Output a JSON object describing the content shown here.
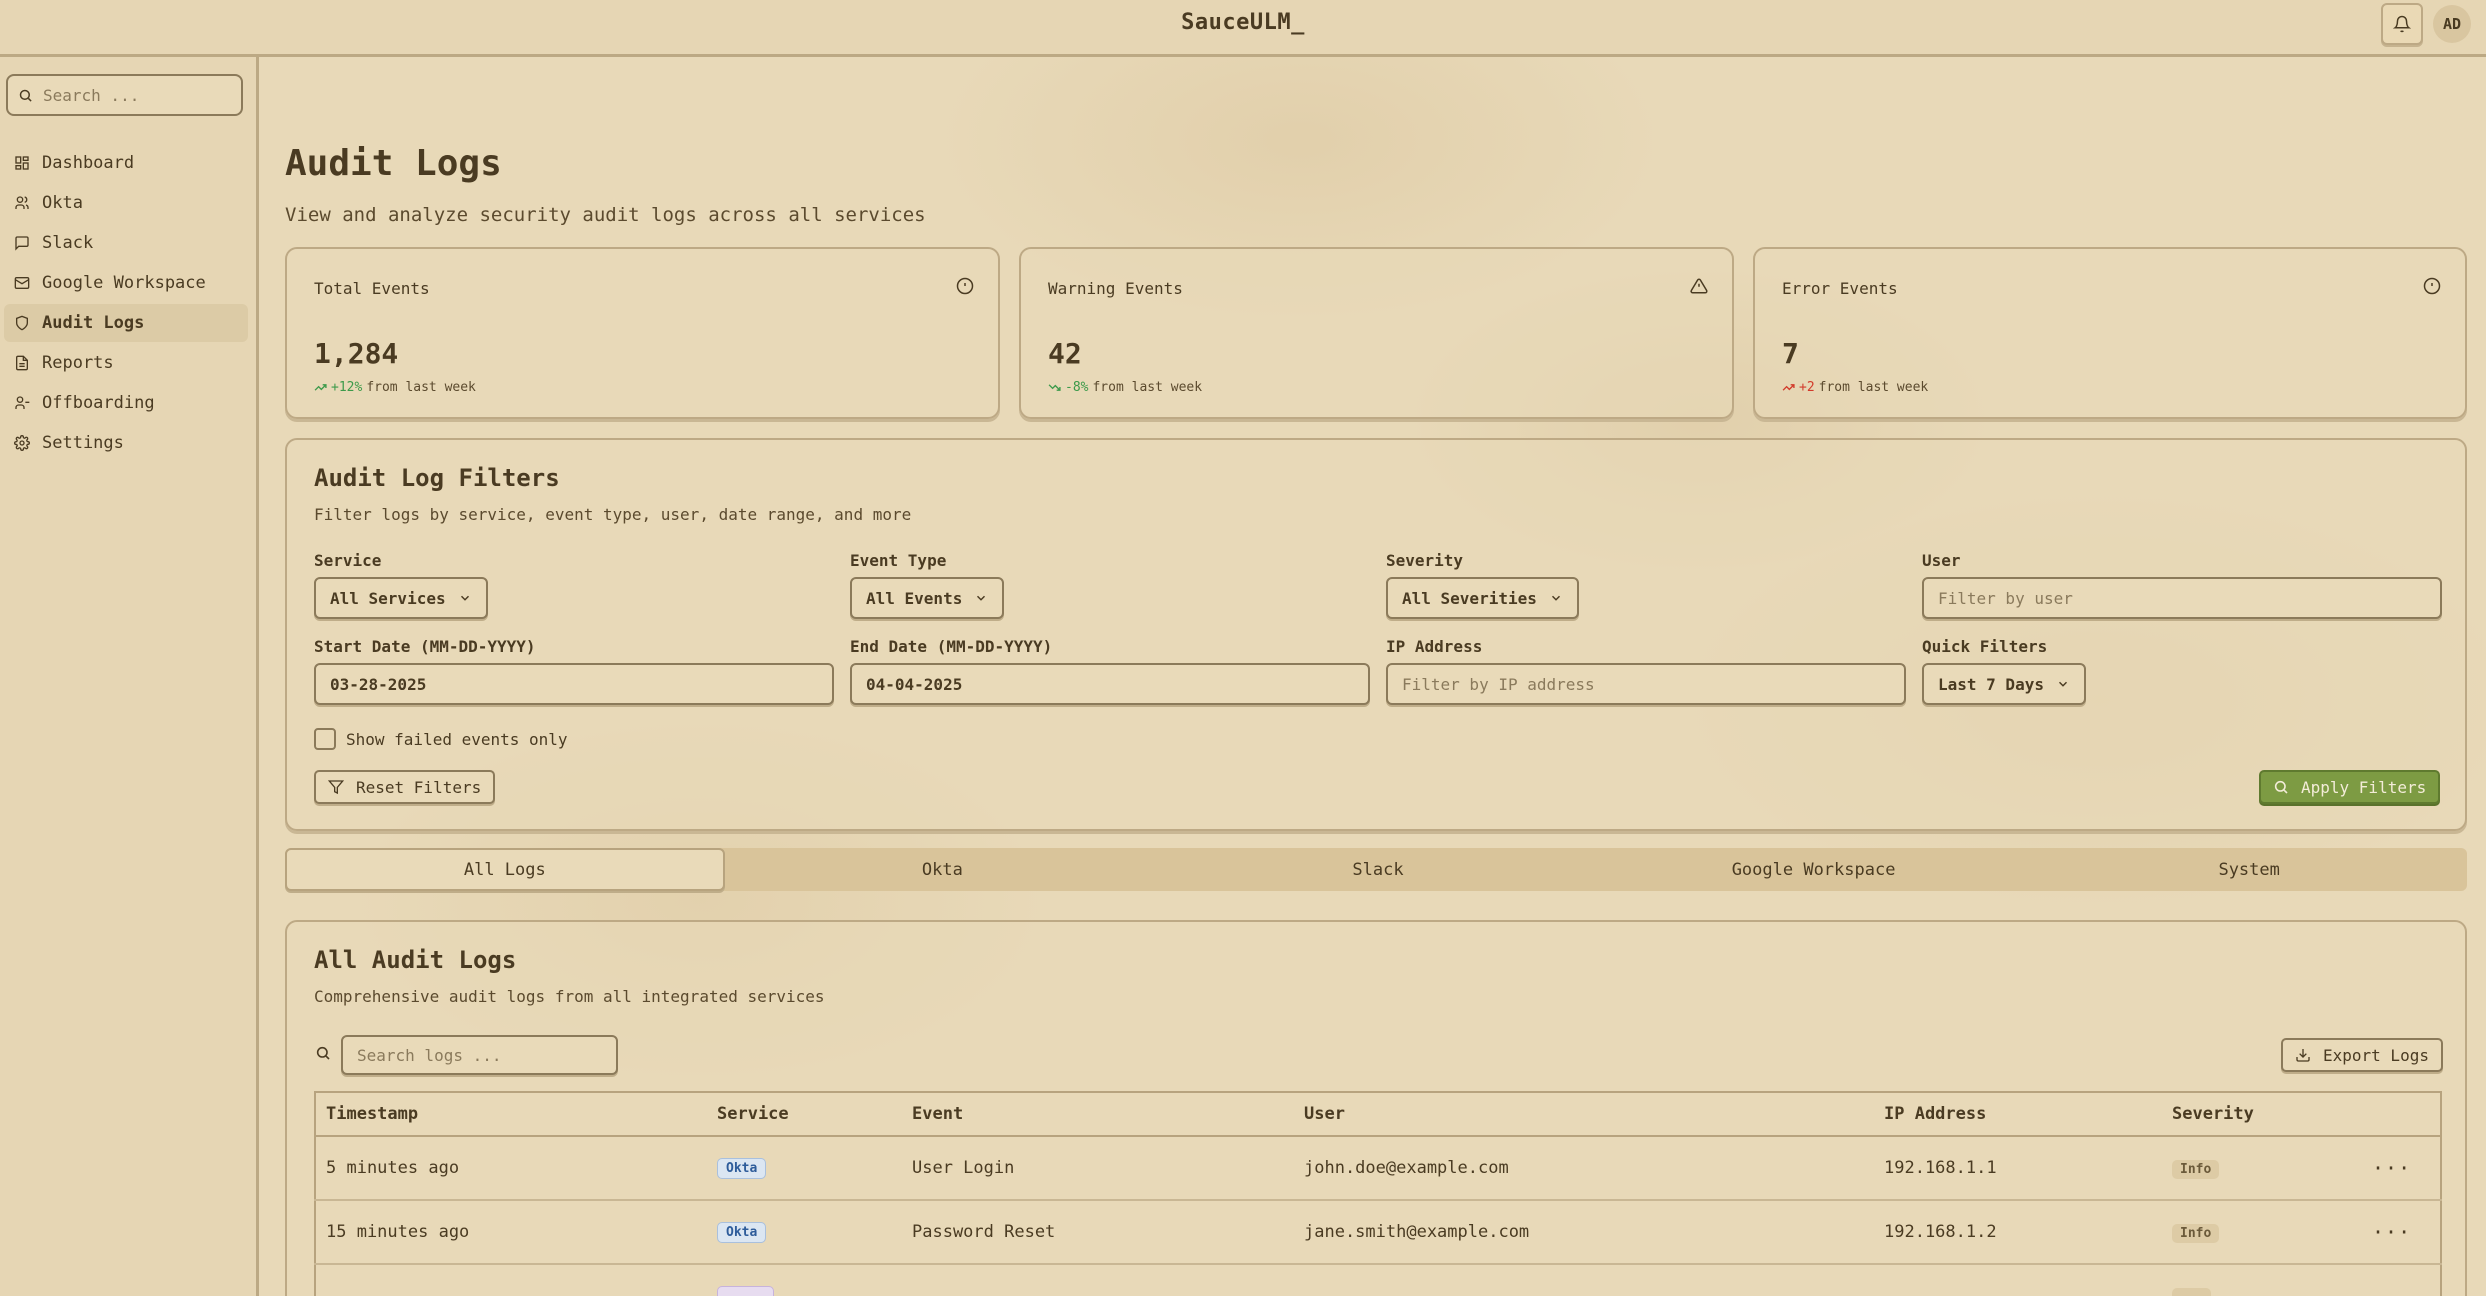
{
  "app": {
    "title": "SauceULM_",
    "avatar_initials": "AD"
  },
  "sidebar": {
    "search_placeholder": "Search ...",
    "items": [
      {
        "label": "Dashboard",
        "icon": "dashboard-icon"
      },
      {
        "label": "Okta",
        "icon": "users-icon"
      },
      {
        "label": "Slack",
        "icon": "message-icon"
      },
      {
        "label": "Google Workspace",
        "icon": "mail-icon"
      },
      {
        "label": "Audit Logs",
        "icon": "shield-icon",
        "active": true
      },
      {
        "label": "Reports",
        "icon": "file-icon"
      },
      {
        "label": "Offboarding",
        "icon": "user-minus-icon"
      },
      {
        "label": "Settings",
        "icon": "gear-icon"
      }
    ]
  },
  "page": {
    "title": "Audit Logs",
    "subtitle": "View and analyze security audit logs across all services"
  },
  "stats": [
    {
      "label": "Total Events",
      "value": "1,284",
      "change": "+12%",
      "change_suffix": "from last week",
      "icon": "info-icon"
    },
    {
      "label": "Warning Events",
      "value": "42",
      "change": "-8%",
      "change_suffix": "from last week",
      "icon": "warning-triangle-icon"
    },
    {
      "label": "Error Events",
      "value": "7",
      "change": "+2",
      "change_suffix": "from last week",
      "icon": "info-icon"
    }
  ],
  "filters": {
    "title": "Audit Log Filters",
    "subtitle": "Filter logs by service, event type, user, date range, and more",
    "service": {
      "label": "Service",
      "value": "All Services"
    },
    "event_type": {
      "label": "Event Type",
      "value": "All Events"
    },
    "severity": {
      "label": "Severity",
      "value": "All Severities"
    },
    "user": {
      "label": "User",
      "placeholder": "Filter by user"
    },
    "start_date": {
      "label": "Start Date (MM-DD-YYYY)",
      "value": "03-28-2025"
    },
    "end_date": {
      "label": "End Date (MM-DD-YYYY)",
      "value": "04-04-2025"
    },
    "ip": {
      "label": "IP Address",
      "placeholder": "Filter by IP address"
    },
    "quick": {
      "label": "Quick Filters",
      "value": "Last 7 Days"
    },
    "failed_only_label": "Show failed events only",
    "reset_label": "Reset Filters",
    "apply_label": "Apply Filters"
  },
  "tabs": [
    "All Logs",
    "Okta",
    "Slack",
    "Google Workspace",
    "System"
  ],
  "logs": {
    "title": "All Audit Logs",
    "subtitle": "Comprehensive audit logs from all integrated services",
    "search_placeholder": "Search logs ...",
    "export_label": "Export Logs",
    "columns": [
      "Timestamp",
      "Service",
      "Event",
      "User",
      "IP Address",
      "Severity"
    ],
    "rows": [
      {
        "timestamp": "5 minutes ago",
        "service": "Okta",
        "event": "User Login",
        "user": "john.doe@example.com",
        "ip": "192.168.1.1",
        "severity": "Info"
      },
      {
        "timestamp": "15 minutes ago",
        "service": "Okta",
        "event": "Password Reset",
        "user": "jane.smith@example.com",
        "ip": "192.168.1.2",
        "severity": "Info"
      }
    ]
  }
}
